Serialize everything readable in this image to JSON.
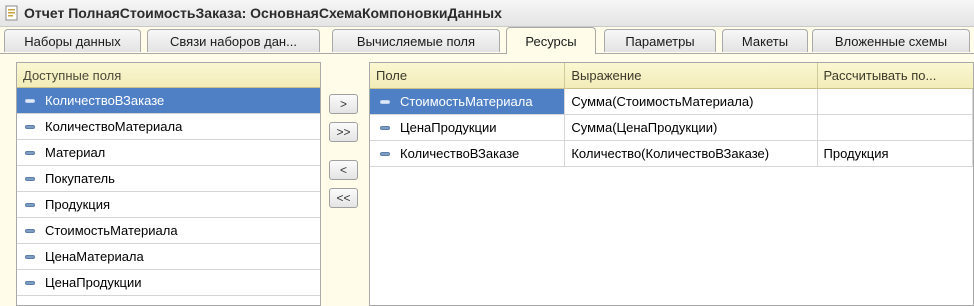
{
  "window": {
    "title": "Отчет ПолнаяСтоимостьЗаказа: ОсновнаяСхемаКомпоновкиДанных",
    "icon": "document-icon"
  },
  "tabs": [
    {
      "label": "Наборы данных"
    },
    {
      "label": "Связи наборов дан..."
    },
    {
      "label": "Вычисляемые поля"
    },
    {
      "label": "Ресурсы"
    },
    {
      "label": "Параметры"
    },
    {
      "label": "Макеты"
    },
    {
      "label": "Вложенные схемы"
    }
  ],
  "active_tab": "Ресурсы",
  "available_fields": {
    "header": "Доступные поля",
    "items": [
      "КоличествоВЗаказе",
      "КоличествоМатериала",
      "Материал",
      "Покупатель",
      "Продукция",
      "СтоимостьМатериала",
      "ЦенаМатериала",
      "ЦенаПродукции"
    ],
    "selected": "КоличествоВЗаказе"
  },
  "move_buttons": [
    ">",
    ">>",
    "<",
    "<<"
  ],
  "resources": {
    "columns": [
      "Поле",
      "Выражение",
      "Рассчитывать по..."
    ],
    "rows": [
      {
        "field": "СтоимостьМатериала",
        "expression": "Сумма(СтоимостьМатериала)",
        "calc_by": ""
      },
      {
        "field": "ЦенаПродукции",
        "expression": "Сумма(ЦенаПродукции)",
        "calc_by": ""
      },
      {
        "field": "КоличествоВЗаказе",
        "expression": "Количество(КоличествоВЗаказе)",
        "calc_by": "Продукция"
      }
    ],
    "selected_row": 0
  },
  "colors": {
    "selection": "#4f80c6",
    "header_bg": "#f6f1c4",
    "page_bg": "#fffde9"
  }
}
